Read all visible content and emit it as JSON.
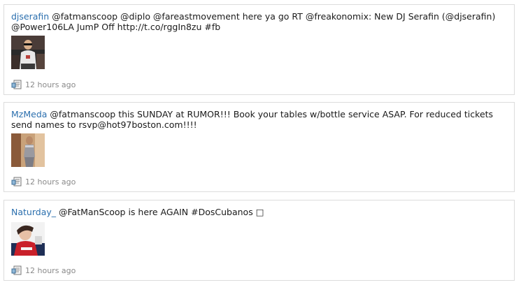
{
  "tweets": [
    {
      "username": "djserafin",
      "text": " @fatmanscoop @diplo @fareastmovement here ya go RT @freakonomix: New DJ Serafin (@djserafin) @Power106LA JumP Off http://t.co/rggIn8zu #fb",
      "timestamp": "12 hours ago",
      "icon": "tweet-meta-icon"
    },
    {
      "username": "MzMeda",
      "text": " @fatmanscoop this SUNDAY at RUMOR!!! Book your tables w/bottle service ASAP. For reduced tickets send names to rsvp@hot97boston.com!!!!",
      "timestamp": "12 hours ago",
      "icon": "tweet-meta-icon"
    },
    {
      "username": "Naturday_",
      "text": " @FatManScoop is here AGAIN #DosCubanos □",
      "timestamp": "12 hours ago",
      "icon": "tweet-meta-icon"
    }
  ],
  "colors": {
    "username": "#2b6fae",
    "timestamp": "#8a8a8a",
    "border": "#dcdcdc"
  }
}
